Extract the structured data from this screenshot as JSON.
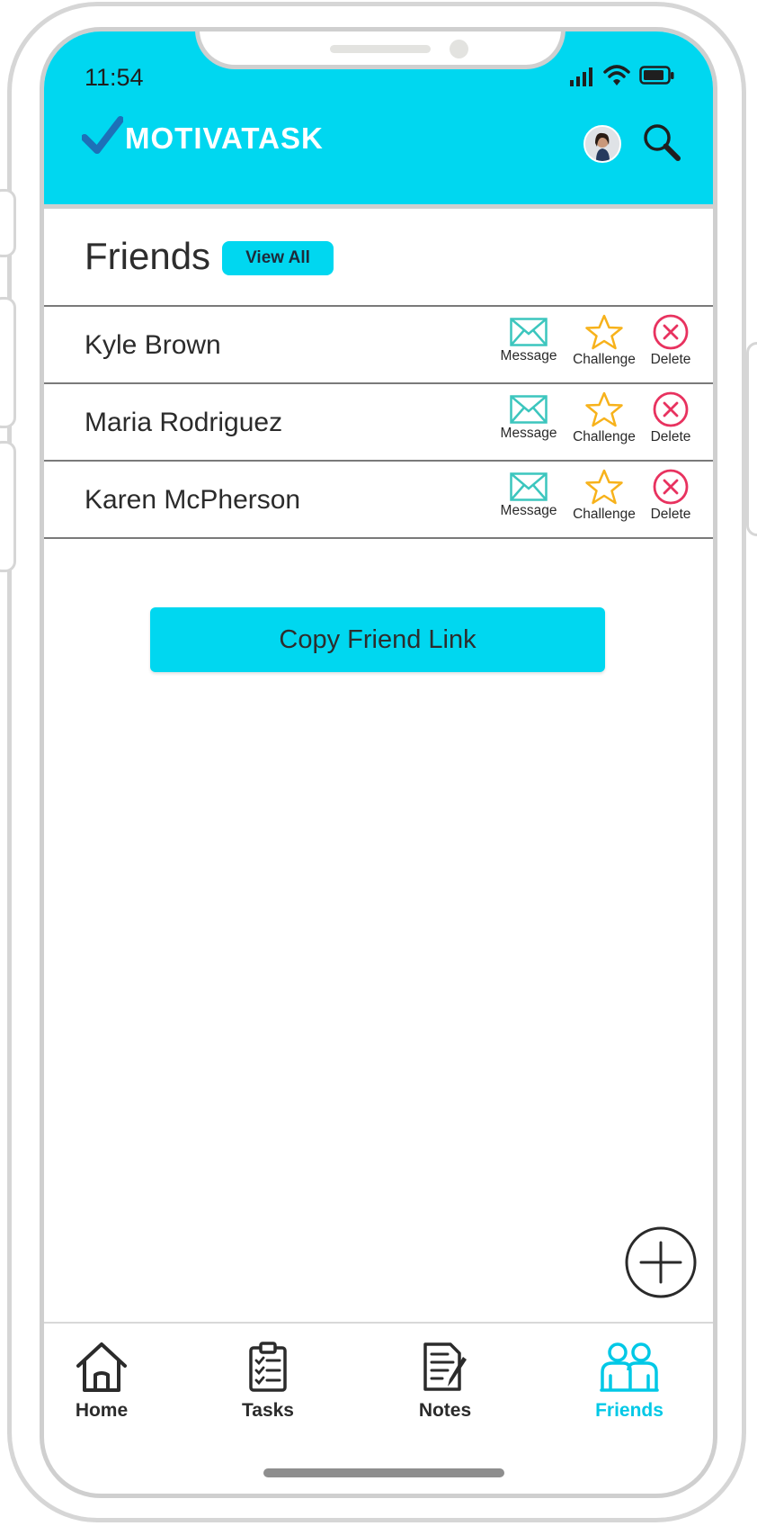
{
  "status_bar": {
    "time": "11:54"
  },
  "header": {
    "brand": "MOTIVATASK"
  },
  "friends_section": {
    "title": "Friends",
    "view_all_label": "View All"
  },
  "friends": [
    {
      "name": "Kyle Brown"
    },
    {
      "name": "Maria Rodriguez"
    },
    {
      "name": "Karen McPherson"
    }
  ],
  "actions": {
    "message": "Message",
    "challenge": "Challenge",
    "delete": "Delete"
  },
  "copy_link_label": "Copy Friend Link",
  "bottom_nav": [
    {
      "label": "Home",
      "icon": "home-icon",
      "active": false
    },
    {
      "label": "Tasks",
      "icon": "clipboard-icon",
      "active": false
    },
    {
      "label": "Notes",
      "icon": "notes-icon",
      "active": false
    },
    {
      "label": "Friends",
      "icon": "friends-icon",
      "active": true
    }
  ],
  "colors": {
    "accent": "#00d7f0",
    "message": "#3cc6be",
    "challenge": "#f7b21b",
    "delete": "#e8325f",
    "active_nav": "#00c8e6"
  }
}
